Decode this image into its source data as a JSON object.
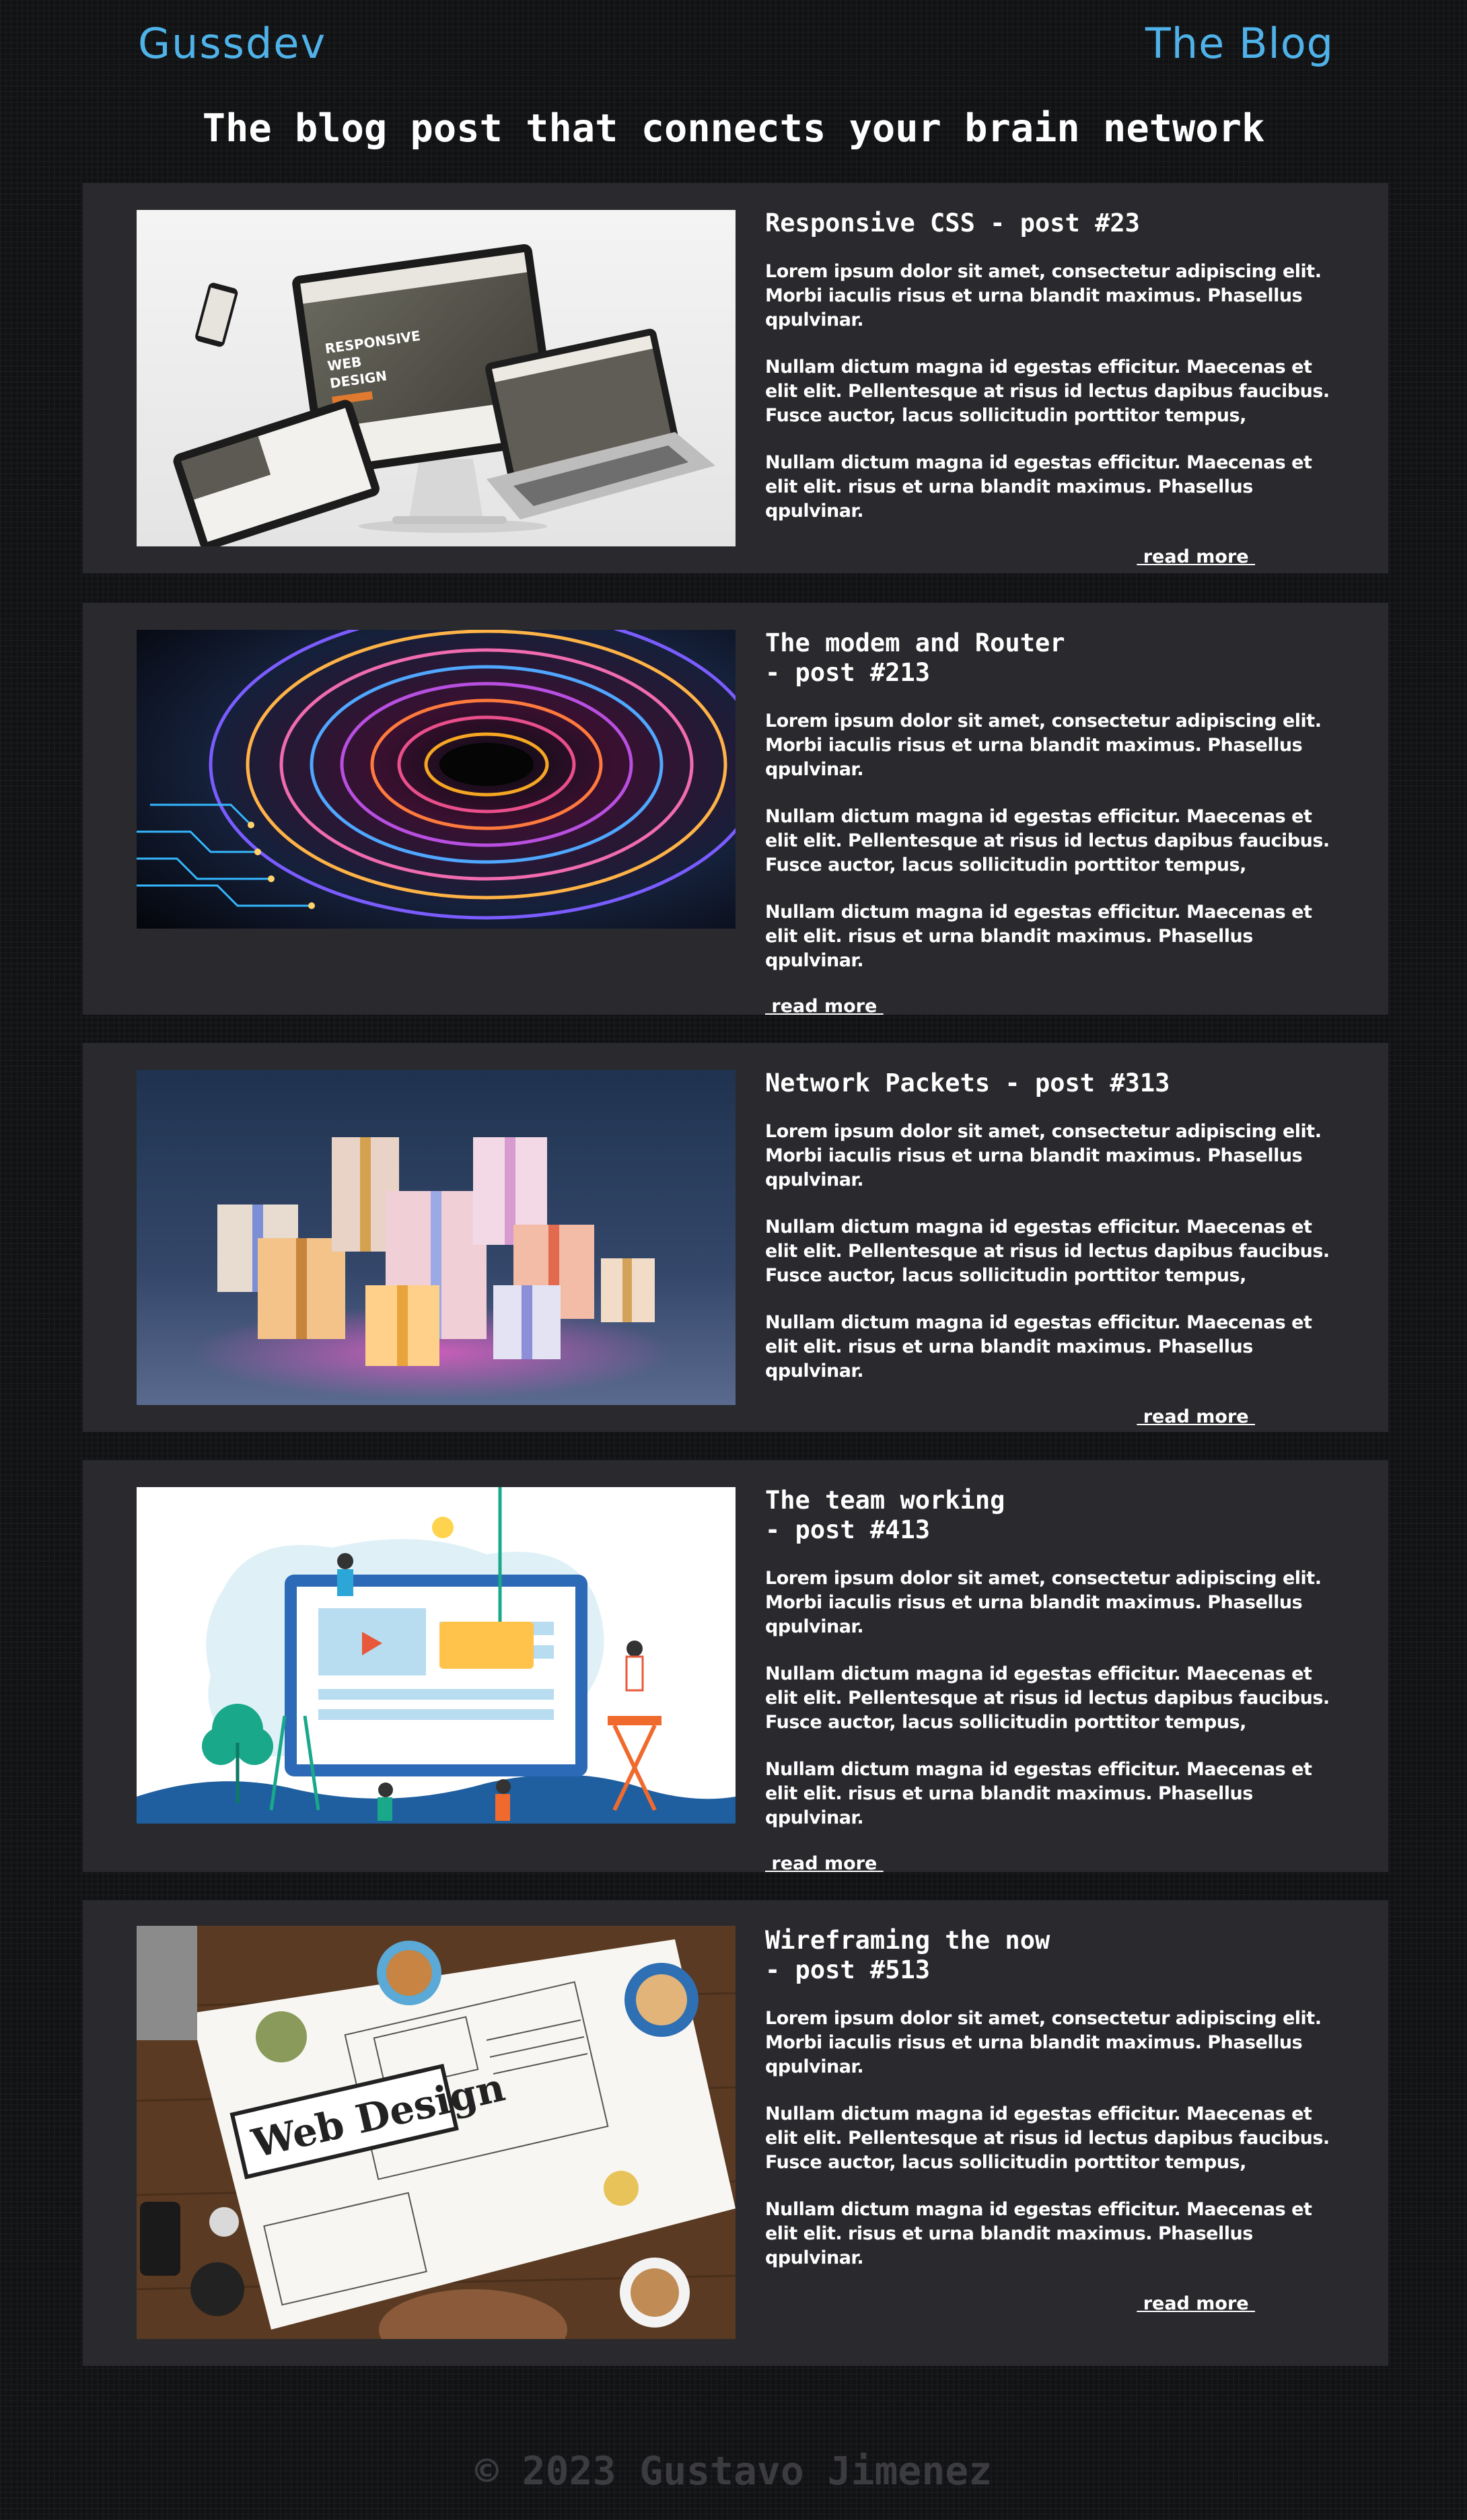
{
  "header": {
    "brand": "Gussdev",
    "blog_link": "The Blog"
  },
  "tagline": "The blog post that connects your brain network",
  "posts": [
    {
      "title": "Responsive CSS - post #23",
      "paragraphs": [
        "Lorem ipsum dolor sit amet, consectetur adipiscing elit. Morbi iaculis risus et urna blandit maximus. Phasellus qpulvinar.",
        "Nullam dictum magna id egestas efficitur. Maecenas et elit elit. Pellentesque at risus id lectus dapibus faucibus. Fusce auctor, lacus sollicitudin porttitor tempus,",
        "Nullam dictum magna id egestas efficitur. Maecenas et elit elit. risus et urna blandit maximus. Phasellus qpulvinar."
      ],
      "read_more": " read more ",
      "image_text": [
        "RESPONSIVE",
        "WEB",
        "DESIGN"
      ]
    },
    {
      "title": "The modem and Router\n- post #213",
      "paragraphs": [
        "Lorem ipsum dolor sit amet, consectetur adipiscing elit. Morbi iaculis risus et urna blandit maximus. Phasellus qpulvinar.",
        "Nullam dictum magna id egestas efficitur. Maecenas et elit elit. Pellentesque at risus id lectus dapibus faucibus. Fusce auctor, lacus sollicitudin porttitor tempus,",
        "Nullam dictum magna id egestas efficitur. Maecenas et elit elit. risus et urna blandit maximus. Phasellus qpulvinar."
      ],
      "read_more": " read more "
    },
    {
      "title": "Network Packets - post #313",
      "paragraphs": [
        "Lorem ipsum dolor sit amet, consectetur adipiscing elit. Morbi iaculis risus et urna blandit maximus. Phasellus qpulvinar.",
        "Nullam dictum magna id egestas efficitur. Maecenas et elit elit. Pellentesque at risus id lectus dapibus faucibus. Fusce auctor, lacus sollicitudin porttitor tempus,",
        "Nullam dictum magna id egestas efficitur. Maecenas et elit elit. risus et urna blandit maximus. Phasellus qpulvinar."
      ],
      "read_more": " read more "
    },
    {
      "title": "The team working\n- post #413",
      "paragraphs": [
        "Lorem ipsum dolor sit amet, consectetur adipiscing elit. Morbi iaculis risus et urna blandit maximus. Phasellus qpulvinar.",
        "Nullam dictum magna id egestas efficitur. Maecenas et elit elit. Pellentesque at risus id lectus dapibus faucibus. Fusce auctor, lacus sollicitudin porttitor tempus,",
        "Nullam dictum magna id egestas efficitur. Maecenas et elit elit. risus et urna blandit maximus. Phasellus qpulvinar."
      ],
      "read_more": " read more "
    },
    {
      "title": "Wireframing the now\n- post #513",
      "paragraphs": [
        "Lorem ipsum dolor sit amet, consectetur adipiscing elit. Morbi iaculis risus et urna blandit maximus. Phasellus qpulvinar.",
        "Nullam dictum magna id egestas efficitur. Maecenas et elit elit. Pellentesque at risus id lectus dapibus faucibus. Fusce auctor, lacus sollicitudin porttitor tempus,",
        "Nullam dictum magna id egestas efficitur. Maecenas et elit elit. risus et urna blandit maximus. Phasellus qpulvinar."
      ],
      "read_more": " read more ",
      "image_text": [
        "Web Design"
      ]
    }
  ],
  "footer": "© 2023 Gustavo Jimenez",
  "colors": {
    "accent": "#4fb3ea",
    "card": "#2a2a2e",
    "page": "#111214",
    "footer_text": "#3b3b40"
  }
}
